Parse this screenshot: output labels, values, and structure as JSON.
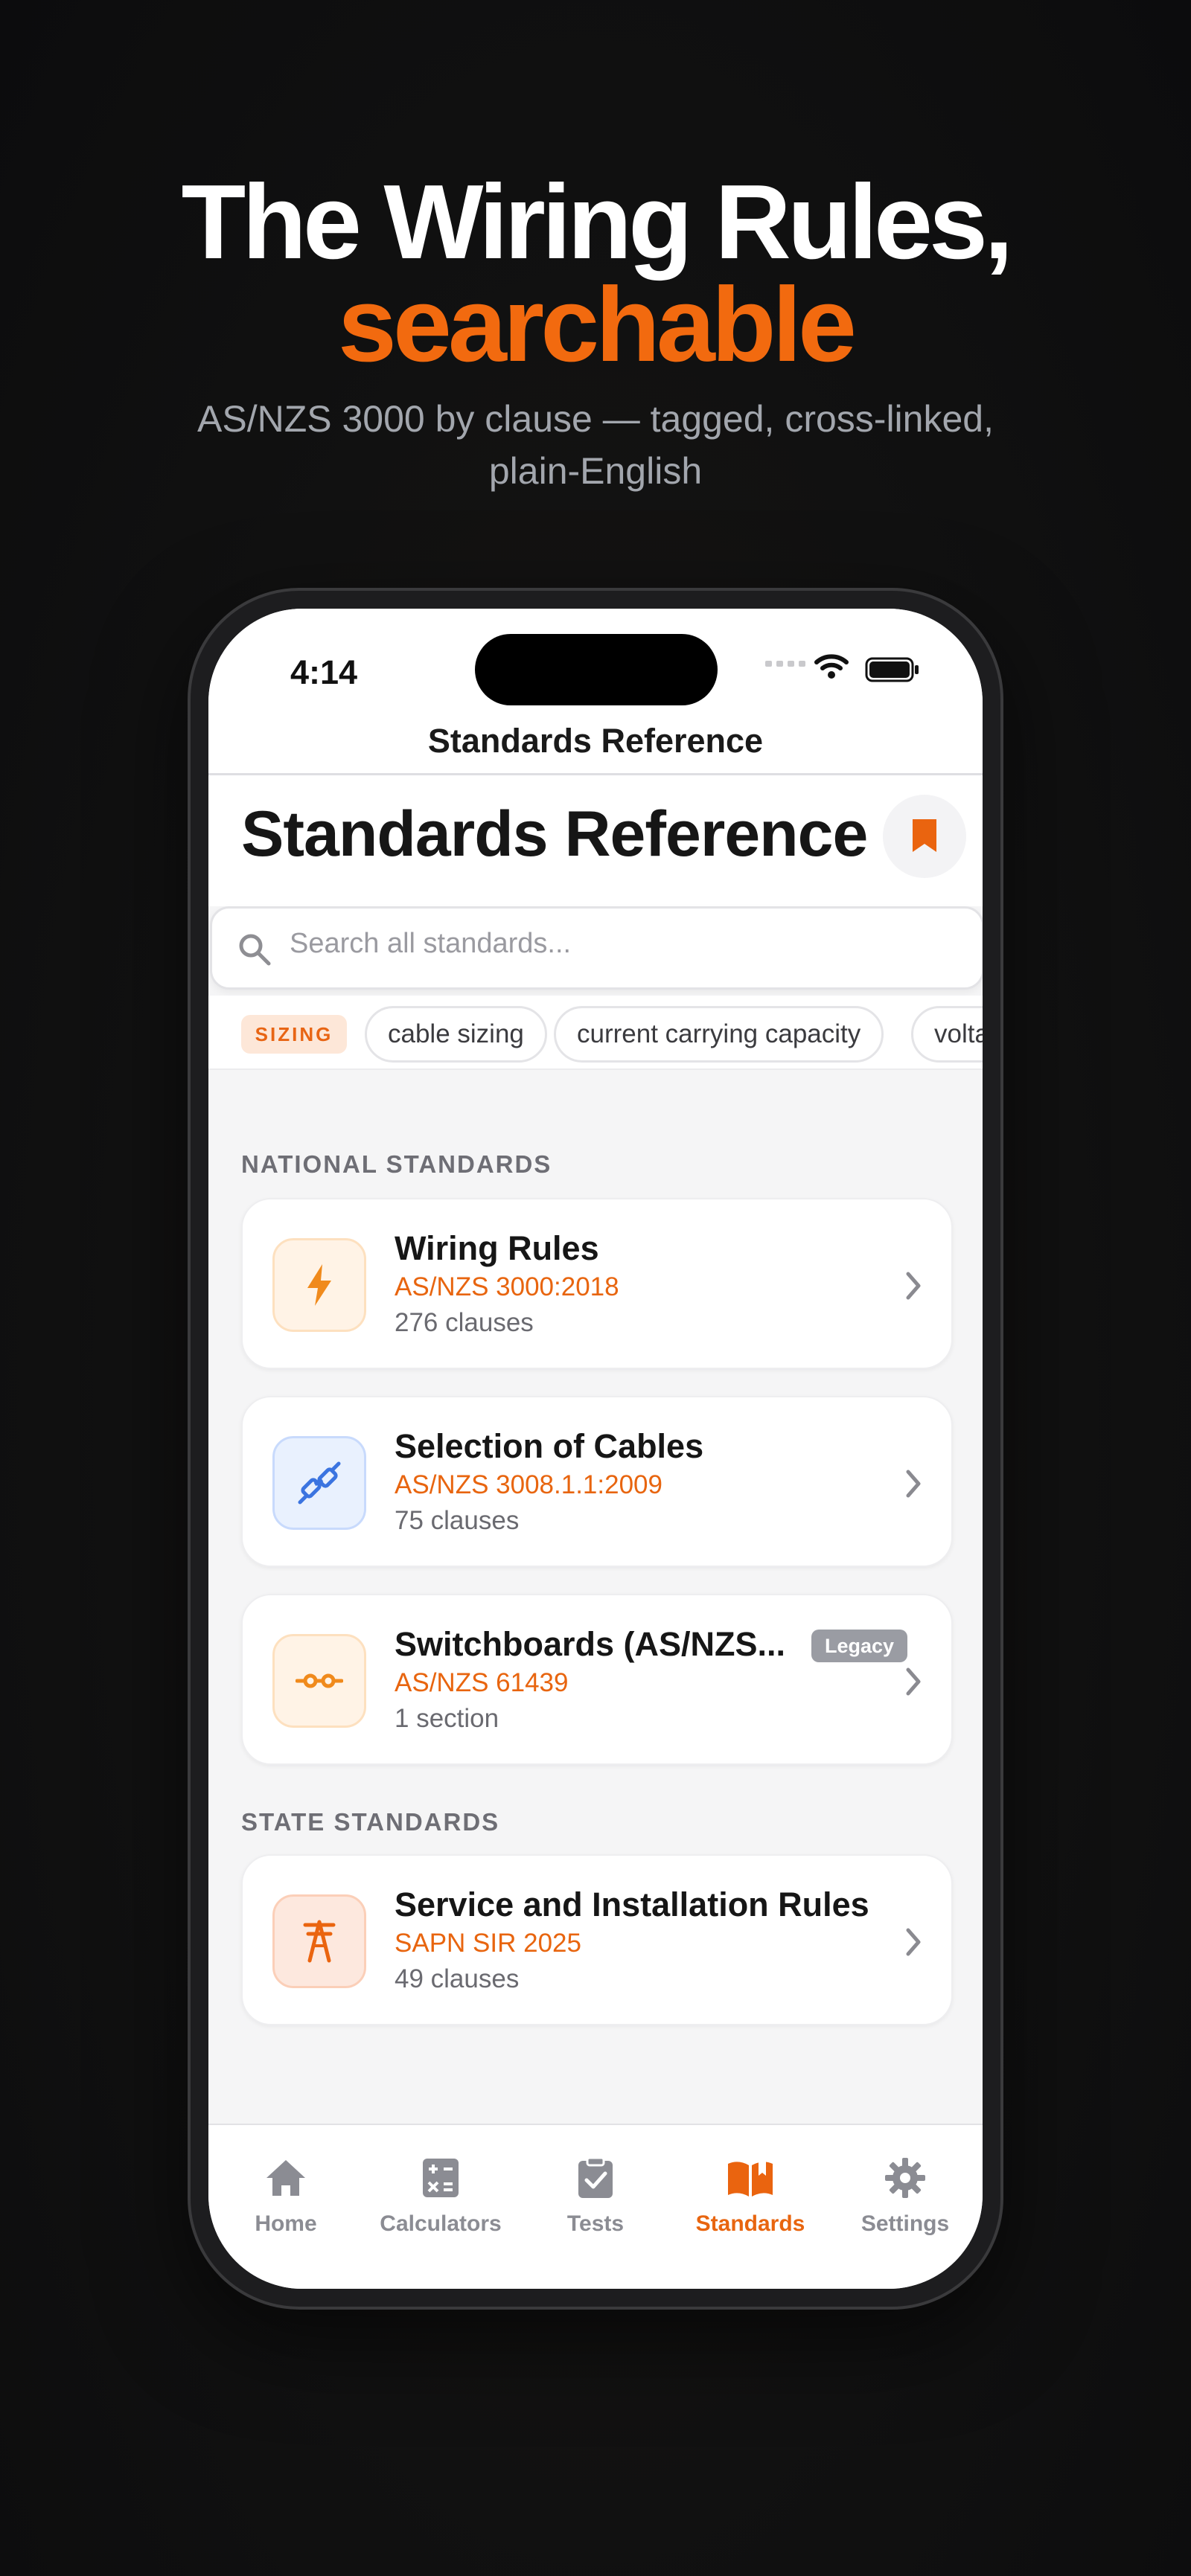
{
  "hero": {
    "line1": "The Wiring Rules,",
    "line2": "searchable",
    "subtitle": "AS/NZS 3000 by clause — tagged, cross-linked, plain-English"
  },
  "status_bar": {
    "time": "4:14"
  },
  "nav": {
    "title": "Standards Reference"
  },
  "page": {
    "large_title": "Standards Reference"
  },
  "search": {
    "placeholder": "Search all standards..."
  },
  "chips": {
    "tag": "SIZING",
    "items": [
      "cable sizing",
      "current carrying capacity",
      "volta"
    ]
  },
  "sections": {
    "national": {
      "label": "NATIONAL STANDARDS",
      "cards": [
        {
          "title": "Wiring Rules",
          "code": "AS/NZS 3000:2018",
          "meta": "276 clauses",
          "icon": "lightning-bolt-icon"
        },
        {
          "title": "Selection of Cables",
          "code": "AS/NZS 3008.1.1:2009",
          "meta": "75 clauses",
          "icon": "cable-plug-icon"
        },
        {
          "title": "Switchboards (AS/NZS...",
          "code": "AS/NZS 61439",
          "meta": "1 section",
          "icon": "switchboard-connector-icon",
          "badge": "Legacy"
        }
      ]
    },
    "state": {
      "label": "STATE STANDARDS",
      "cards": [
        {
          "title": "Service and Installation Rules",
          "code": "SAPN SIR 2025",
          "meta": "49 clauses",
          "icon": "transmission-tower-icon"
        }
      ]
    }
  },
  "tabs": [
    {
      "label": "Home",
      "icon": "home-icon"
    },
    {
      "label": "Calculators",
      "icon": "calculator-icon"
    },
    {
      "label": "Tests",
      "icon": "clipboard-check-icon"
    },
    {
      "label": "Standards",
      "icon": "book-icon",
      "active": true
    },
    {
      "label": "Settings",
      "icon": "gear-icon"
    }
  ],
  "colors": {
    "accent": "#f26a0f",
    "background": "#111111",
    "screen": "#f5f5f6"
  }
}
